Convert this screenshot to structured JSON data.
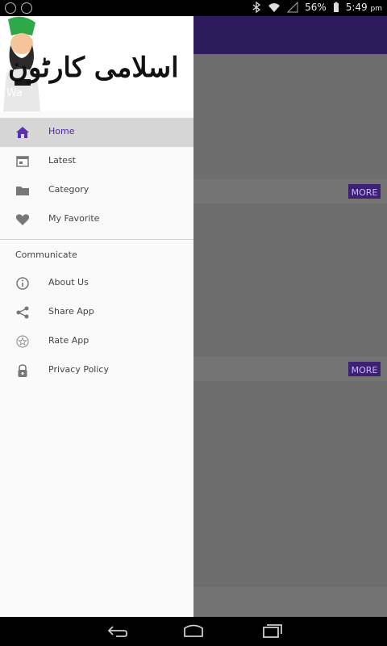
{
  "status_bar": {
    "battery": "56%",
    "time": "5:49",
    "ampm": "pm"
  },
  "header": {
    "title_urdu": "اسلامی کارٹون",
    "subtitle": "Wa"
  },
  "menu": {
    "items": [
      {
        "label": "Home",
        "icon": "home-icon",
        "active": true
      },
      {
        "label": "Latest",
        "icon": "latest-icon",
        "active": false
      },
      {
        "label": "Category",
        "icon": "folder-icon",
        "active": false
      },
      {
        "label": "My Favorite",
        "icon": "heart-icon",
        "active": false
      }
    ],
    "communicate_heading": "Communicate",
    "comm_items": [
      {
        "label": "About Us",
        "icon": "info-icon"
      },
      {
        "label": "Share App",
        "icon": "share-icon"
      },
      {
        "label": "Rate App",
        "icon": "star-icon"
      },
      {
        "label": "Privacy Policy",
        "icon": "lock-icon"
      }
    ]
  },
  "background": {
    "more_label": "MORE"
  },
  "colors": {
    "accent": "#5b2fb5",
    "toolbar": "#2c1a5c",
    "active_row": "#d6d6d6"
  }
}
